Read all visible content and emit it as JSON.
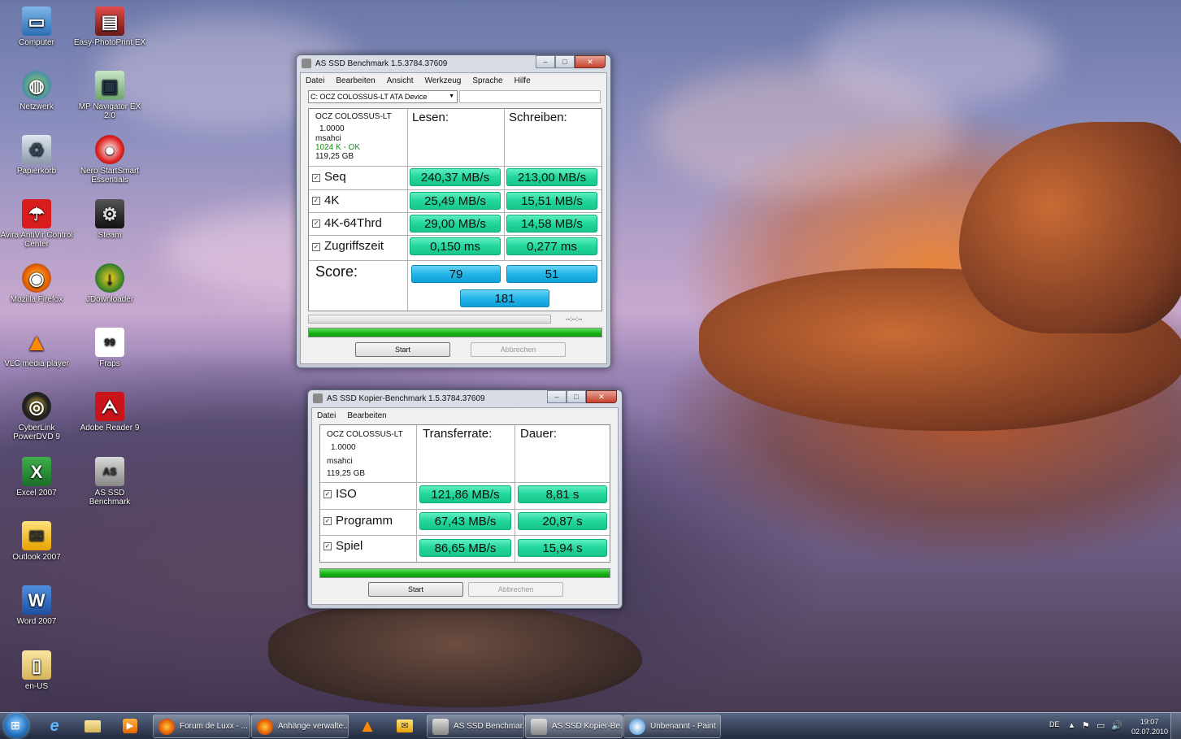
{
  "desktop": {
    "icons": [
      {
        "label": "Computer",
        "icon": "computer-icon"
      },
      {
        "label": "Easy-PhotoPrint EX",
        "icon": "photoprint-icon"
      },
      {
        "label": "Netzwerk",
        "icon": "network-icon"
      },
      {
        "label": "MP Navigator EX 2.0",
        "icon": "scanner-icon"
      },
      {
        "label": "Papierkorb",
        "icon": "recycle-bin-icon"
      },
      {
        "label": "Nero StartSmart Essentials",
        "icon": "nero-icon"
      },
      {
        "label": "Avira AntiVir Control Center",
        "icon": "avira-icon"
      },
      {
        "label": "Steam",
        "icon": "steam-icon"
      },
      {
        "label": "Mozilla Firefox",
        "icon": "firefox-icon"
      },
      {
        "label": "JDownloader",
        "icon": "jdownloader-icon"
      },
      {
        "label": "VLC media player",
        "icon": "vlc-icon"
      },
      {
        "label": "Fraps",
        "icon": "fraps-icon"
      },
      {
        "label": "CyberLink PowerDVD 9",
        "icon": "powerdvd-icon"
      },
      {
        "label": "Adobe Reader 9",
        "icon": "adobe-reader-icon"
      },
      {
        "label": "Excel 2007",
        "icon": "excel-icon"
      },
      {
        "label": "AS SSD Benchmark",
        "icon": "as-ssd-icon"
      },
      {
        "label": "Outlook 2007",
        "icon": "outlook-icon"
      },
      {
        "label": "Word 2007",
        "icon": "word-icon"
      },
      {
        "label": "en-US",
        "icon": "folder-icon"
      }
    ]
  },
  "bench": {
    "title": "AS SSD Benchmark 1.5.3784.37609",
    "menu": [
      "Datei",
      "Bearbeiten",
      "Ansicht",
      "Werkzeug",
      "Sprache",
      "Hilfe"
    ],
    "drive_select": "C: OCZ COLOSSUS-LT ATA Device",
    "device": {
      "name": "OCZ COLOSSUS-LT",
      "fw": "1.0000",
      "driver": "msahci",
      "align": "1024 K - OK",
      "size": "119,25 GB"
    },
    "col_read": "Lesen:",
    "col_write": "Schreiben:",
    "rows": [
      {
        "label": "Seq",
        "read": "240,37 MB/s",
        "write": "213,00 MB/s"
      },
      {
        "label": "4K",
        "read": "25,49 MB/s",
        "write": "15,51 MB/s"
      },
      {
        "label": "4K-64Thrd",
        "read": "29,00 MB/s",
        "write": "14,58 MB/s"
      },
      {
        "label": "Zugriffszeit",
        "read": "0,150 ms",
        "write": "0,277 ms"
      }
    ],
    "score_label": "Score:",
    "score_read": "79",
    "score_write": "51",
    "score_total": "181",
    "time": "--:--:--",
    "start": "Start",
    "cancel": "Abbrechen",
    "progress": 1.0
  },
  "copy": {
    "title": "AS SSD Kopier-Benchmark 1.5.3784.37609",
    "menu": [
      "Datei",
      "Bearbeiten"
    ],
    "device": {
      "name": "OCZ COLOSSUS-LT",
      "fw": "1.0000",
      "driver": "msahci",
      "size": "119,25 GB"
    },
    "col_rate": "Transferrate:",
    "col_time": "Dauer:",
    "rows": [
      {
        "label": "ISO",
        "rate": "121,86 MB/s",
        "time": "8,81 s"
      },
      {
        "label": "Programm",
        "rate": "67,43 MB/s",
        "time": "20,87 s"
      },
      {
        "label": "Spiel",
        "rate": "86,65 MB/s",
        "time": "15,94 s"
      }
    ],
    "start": "Start",
    "cancel": "Abbrechen",
    "progress": 1.0
  },
  "taskbar": {
    "items": [
      {
        "label": "Forum de Luxx - ...",
        "icon": "firefox-icon"
      },
      {
        "label": "Anhänge verwalte...",
        "icon": "firefox-icon"
      },
      {
        "label": "AS SSD Benchmar...",
        "icon": "as-ssd-icon"
      },
      {
        "label": "AS SSD Kopier-Be...",
        "icon": "as-ssd-icon"
      },
      {
        "label": "Unbenannt - Paint",
        "icon": "paint-icon"
      }
    ],
    "lang": "DE",
    "time": "19:07",
    "date": "02.07.2010"
  }
}
